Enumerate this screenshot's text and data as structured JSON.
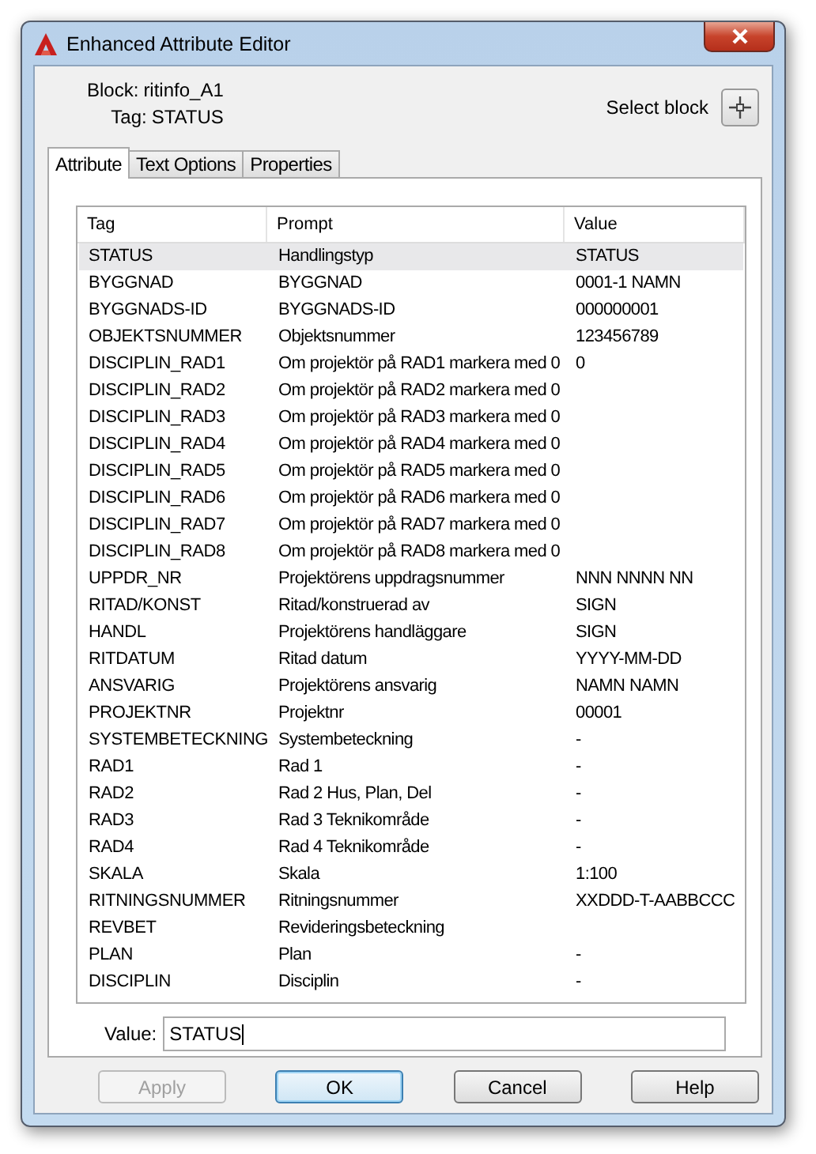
{
  "window": {
    "title": "Enhanced Attribute Editor"
  },
  "block_info": {
    "block_label": "Block:",
    "block_value": "ritinfo_A1",
    "tag_label": "Tag:",
    "tag_value": "STATUS"
  },
  "select_block": {
    "label": "Select block"
  },
  "tabs": [
    {
      "label": "Attribute",
      "selected": true
    },
    {
      "label": "Text Options",
      "selected": false
    },
    {
      "label": "Properties",
      "selected": false
    }
  ],
  "table": {
    "columns": [
      "Tag",
      "Prompt",
      "Value"
    ],
    "rows": [
      {
        "tag": "STATUS",
        "prompt": "Handlingstyp",
        "value": "STATUS",
        "selected": true
      },
      {
        "tag": "BYGGNAD",
        "prompt": "BYGGNAD",
        "value": "0001-1 NAMN",
        "selected": false
      },
      {
        "tag": "BYGGNADS-ID",
        "prompt": "BYGGNADS-ID",
        "value": "000000001",
        "selected": false
      },
      {
        "tag": "OBJEKTSNUMMER",
        "prompt": "Objektsnummer",
        "value": "123456789",
        "selected": false
      },
      {
        "tag": "DISCIPLIN_RAD1",
        "prompt": "Om projektör på RAD1 markera med 0",
        "value": "0",
        "selected": false
      },
      {
        "tag": "DISCIPLIN_RAD2",
        "prompt": "Om projektör på RAD2 markera med 0",
        "selected": false
      },
      {
        "tag": "DISCIPLIN_RAD3",
        "prompt": "Om projektör på RAD3 markera med 0",
        "selected": false
      },
      {
        "tag": "DISCIPLIN_RAD4",
        "prompt": "Om projektör på RAD4 markera med 0",
        "selected": false
      },
      {
        "tag": "DISCIPLIN_RAD5",
        "prompt": "Om projektör på RAD5 markera med 0",
        "selected": false
      },
      {
        "tag": "DISCIPLIN_RAD6",
        "prompt": "Om projektör på RAD6 markera med 0",
        "selected": false
      },
      {
        "tag": "DISCIPLIN_RAD7",
        "prompt": "Om projektör på RAD7 markera med 0",
        "selected": false
      },
      {
        "tag": "DISCIPLIN_RAD8",
        "prompt": "Om projektör på RAD8 markera med 0",
        "selected": false
      },
      {
        "tag": "UPPDR_NR",
        "prompt": "Projektörens uppdragsnummer",
        "value": "NNN NNNN NN",
        "selected": false
      },
      {
        "tag": "RITAD/KONST",
        "prompt": "Ritad/konstruerad av",
        "value": "SIGN",
        "selected": false
      },
      {
        "tag": "HANDL",
        "prompt": "Projektörens handläggare",
        "value": "SIGN",
        "selected": false
      },
      {
        "tag": "RITDATUM",
        "prompt": "Ritad datum",
        "value": "YYYY-MM-DD",
        "selected": false
      },
      {
        "tag": "ANSVARIG",
        "prompt": "Projektörens ansvarig",
        "value": "NAMN NAMN",
        "selected": false
      },
      {
        "tag": "PROJEKTNR",
        "prompt": "Projektnr",
        "value": "00001",
        "selected": false
      },
      {
        "tag": "SYSTEMBETECKNING",
        "prompt": "Systembeteckning",
        "value": "-",
        "selected": false
      },
      {
        "tag": "RAD1",
        "prompt": "Rad 1",
        "value": "-",
        "selected": false
      },
      {
        "tag": "RAD2",
        "prompt": "Rad 2 Hus, Plan, Del",
        "value": "-",
        "selected": false
      },
      {
        "tag": "RAD3",
        "prompt": "Rad 3 Teknikområde",
        "value": "-",
        "selected": false
      },
      {
        "tag": "RAD4",
        "prompt": "Rad 4 Teknikområde",
        "value": "-",
        "selected": false
      },
      {
        "tag": "SKALA",
        "prompt": "Skala",
        "value": "1:100",
        "selected": false
      },
      {
        "tag": "RITNINGSNUMMER",
        "prompt": "Ritningsnummer",
        "value": "XXDDD-T-AABBCCC",
        "selected": false
      },
      {
        "tag": "REVBET",
        "prompt": "Revideringsbeteckning",
        "selected": false
      },
      {
        "tag": "PLAN",
        "prompt": "Plan",
        "value": "-",
        "selected": false
      },
      {
        "tag": "DISCIPLIN",
        "prompt": "Disciplin",
        "value": "-",
        "selected": false
      }
    ]
  },
  "value_field": {
    "label": "Value:",
    "value": "STATUS"
  },
  "buttons": [
    {
      "label": "Apply",
      "disabled": true,
      "default": false
    },
    {
      "label": "OK",
      "disabled": false,
      "default": true
    },
    {
      "label": "Cancel",
      "disabled": false,
      "default": false
    },
    {
      "label": "Help",
      "disabled": false,
      "default": false
    }
  ]
}
